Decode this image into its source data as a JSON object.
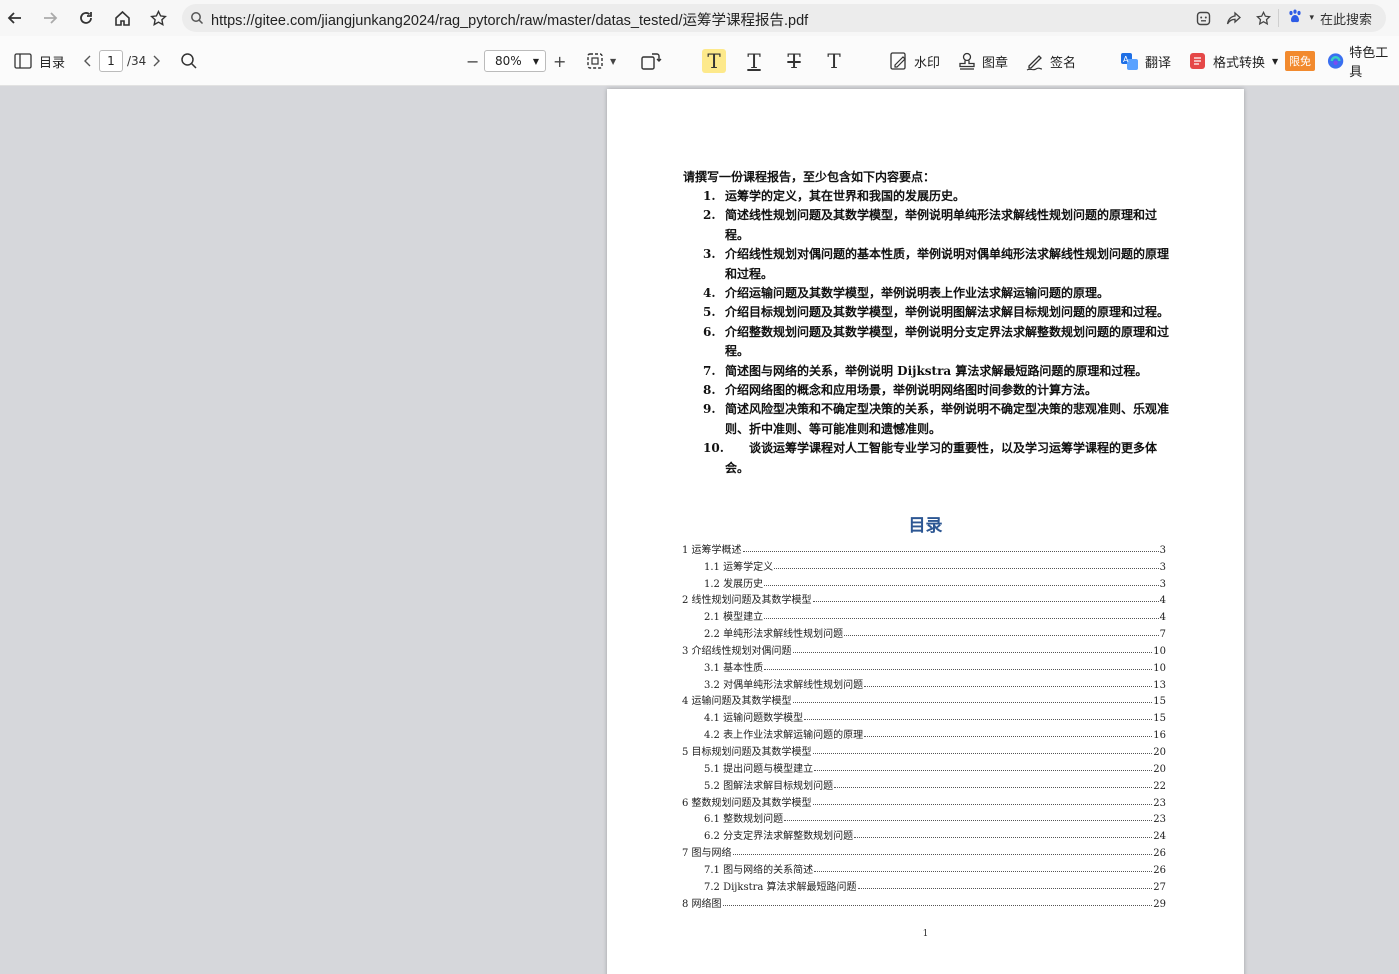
{
  "browser": {
    "url": "https://gitee.com/jiangjunkang2024/rag_pytorch/raw/master/datas_tested/运筹学课程报告.pdf",
    "search_label": "在此搜索"
  },
  "toolbar": {
    "toc_label": "目录",
    "current_page": "1",
    "total_pages": "/34",
    "zoom": "80%",
    "watermark_label": "水印",
    "stamp_label": "图章",
    "sign_label": "签名",
    "translate_label": "翻译",
    "convert_label": "格式转换",
    "limited_badge": "限免",
    "special_tools_label": "特色工具",
    "colors": {
      "highlight_active": "#fde98b",
      "limited_badge": "#f28a2e",
      "translate_icon": "#1f6fe5",
      "convert_icon": "#e54848"
    }
  },
  "document": {
    "request_title": "请撰写一份课程报告，至少包含如下内容要点：",
    "requirements": [
      {
        "num": "1.",
        "text": "运筹学的定义，其在世界和我国的发展历史。"
      },
      {
        "num": "2.",
        "text": "简述线性规划问题及其数学模型，举例说明单纯形法求解线性规划问题的原理和过程。"
      },
      {
        "num": "3.",
        "text": "介绍线性规划对偶问题的基本性质，举例说明对偶单纯形法求解线性规划问题的原理和过程。"
      },
      {
        "num": "4.",
        "text": "介绍运输问题及其数学模型，举例说明表上作业法求解运输问题的原理。"
      },
      {
        "num": "5.",
        "text": "介绍目标规划问题及其数学模型，举例说明图解法求解目标规划问题的原理和过程。"
      },
      {
        "num": "6.",
        "text": "介绍整数规划问题及其数学模型，举例说明分支定界法求解整数规划问题的原理和过程。"
      },
      {
        "num": "7.",
        "text": "简述图与网络的关系，举例说明 Dijkstra 算法求解最短路问题的原理和过程。"
      },
      {
        "num": "8.",
        "text": "介绍网络图的概念和应用场景，举例说明网络图时间参数的计算方法。"
      },
      {
        "num": "9.",
        "text": "简述风险型决策和不确定型决策的关系，举例说明不确定型决策的悲观准则、乐观准则、折中准则、等可能准则和遗憾准则。"
      },
      {
        "num": "10.",
        "text": "谈谈运筹学课程对人工智能专业学习的重要性，以及学习运筹学课程的更多体会。"
      }
    ],
    "toc_title": "目录",
    "toc": [
      {
        "title": "1 运筹学概述",
        "page": "3",
        "level": 1
      },
      {
        "title": "1.1 运筹学定义",
        "page": "3",
        "level": 2
      },
      {
        "title": "1.2 发展历史",
        "page": "3",
        "level": 2
      },
      {
        "title": "2 线性规划问题及其数学模型",
        "page": "4",
        "level": 1
      },
      {
        "title": "2.1 模型建立",
        "page": "4",
        "level": 2
      },
      {
        "title": "2.2 单纯形法求解线性规划问题",
        "page": "7",
        "level": 2
      },
      {
        "title": "3 介绍线性规划对偶问题",
        "page": "10",
        "level": 1
      },
      {
        "title": "3.1 基本性质",
        "page": "10",
        "level": 2
      },
      {
        "title": "3.2 对偶单纯形法求解线性规划问题",
        "page": "13",
        "level": 2
      },
      {
        "title": "4 运输问题及其数学模型",
        "page": "15",
        "level": 1
      },
      {
        "title": "4.1 运输问题数学模型",
        "page": "15",
        "level": 2
      },
      {
        "title": "4.2 表上作业法求解运输问题的原理",
        "page": "16",
        "level": 2
      },
      {
        "title": "5 目标规划问题及其数学模型",
        "page": "20",
        "level": 1
      },
      {
        "title": "5.1  提出问题与模型建立",
        "page": "20",
        "level": 2
      },
      {
        "title": "5.2  图解法求解目标规划问题",
        "page": "22",
        "level": 2
      },
      {
        "title": "6 整数规划问题及其数学模型",
        "page": "23",
        "level": 1
      },
      {
        "title": "6.1  整数规划问题",
        "page": "23",
        "level": 2
      },
      {
        "title": "6.2  分支定界法求解整数规划问题",
        "page": "24",
        "level": 2
      },
      {
        "title": "7 图与网络",
        "page": "26",
        "level": 1
      },
      {
        "title": "7.1  图与网络的关系简述",
        "page": "26",
        "level": 2
      },
      {
        "title": "7.2  Dijkstra 算法求解最短路问题",
        "page": "27",
        "level": 2
      },
      {
        "title": "8 网络图",
        "page": "29",
        "level": 1
      }
    ],
    "page_number": "1"
  }
}
